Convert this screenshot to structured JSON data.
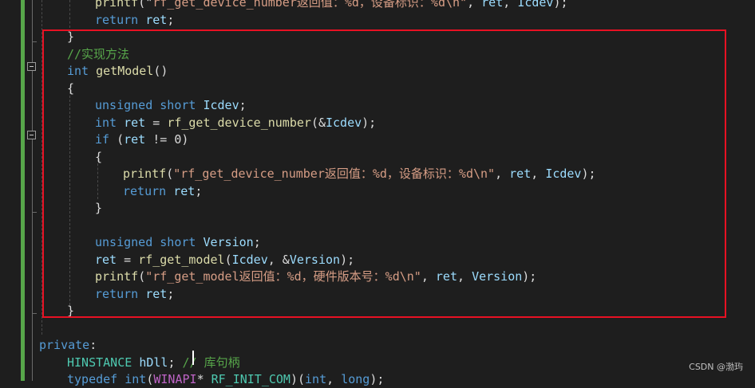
{
  "editor": {
    "lines": [
      {
        "indent": 2,
        "tokens": [
          [
            "fn",
            "printf"
          ],
          [
            "pl",
            "(\""
          ],
          [
            "st",
            "rf_get_device_number返回值：%d，设备标识：%d\\n\""
          ],
          [
            "pl",
            ", "
          ],
          [
            "va",
            "ret"
          ],
          [
            "pl",
            ", "
          ],
          [
            "va",
            "Icdev"
          ],
          [
            "pl",
            ");"
          ]
        ]
      },
      {
        "indent": 2,
        "tokens": [
          [
            "kw",
            "return"
          ],
          [
            "pl",
            " "
          ],
          [
            "va",
            "ret"
          ],
          [
            "pl",
            ";"
          ]
        ]
      },
      {
        "indent": 1,
        "tokens": [
          [
            "pl",
            "}"
          ]
        ]
      },
      {
        "indent": 1,
        "tokens": [
          [
            "cm",
            "//实现方法"
          ]
        ]
      },
      {
        "indent": 1,
        "tokens": [
          [
            "kw",
            "int"
          ],
          [
            "pl",
            " "
          ],
          [
            "fn",
            "getModel"
          ],
          [
            "pl",
            "()"
          ]
        ]
      },
      {
        "indent": 1,
        "tokens": [
          [
            "pl",
            "{"
          ]
        ]
      },
      {
        "indent": 2,
        "tokens": [
          [
            "kw",
            "unsigned short"
          ],
          [
            "pl",
            " "
          ],
          [
            "va",
            "Icdev"
          ],
          [
            "pl",
            ";"
          ]
        ]
      },
      {
        "indent": 2,
        "tokens": [
          [
            "kw",
            "int"
          ],
          [
            "pl",
            " "
          ],
          [
            "va",
            "ret"
          ],
          [
            "pl",
            " = "
          ],
          [
            "fn",
            "rf_get_device_number"
          ],
          [
            "pl",
            "(&"
          ],
          [
            "va",
            "Icdev"
          ],
          [
            "pl",
            ");"
          ]
        ]
      },
      {
        "indent": 2,
        "tokens": [
          [
            "kw",
            "if"
          ],
          [
            "pl",
            " ("
          ],
          [
            "va",
            "ret"
          ],
          [
            "pl",
            " != 0)"
          ]
        ]
      },
      {
        "indent": 2,
        "tokens": [
          [
            "pl",
            "{"
          ]
        ]
      },
      {
        "indent": 3,
        "tokens": [
          [
            "fn",
            "printf"
          ],
          [
            "pl",
            "("
          ],
          [
            "st",
            "\"rf_get_device_number返回值：%d，设备标识：%d\\n\""
          ],
          [
            "pl",
            ", "
          ],
          [
            "va",
            "ret"
          ],
          [
            "pl",
            ", "
          ],
          [
            "va",
            "Icdev"
          ],
          [
            "pl",
            ");"
          ]
        ]
      },
      {
        "indent": 3,
        "tokens": [
          [
            "kw",
            "return"
          ],
          [
            "pl",
            " "
          ],
          [
            "va",
            "ret"
          ],
          [
            "pl",
            ";"
          ]
        ]
      },
      {
        "indent": 2,
        "tokens": [
          [
            "pl",
            "}"
          ]
        ]
      },
      {
        "indent": 0,
        "tokens": []
      },
      {
        "indent": 2,
        "tokens": [
          [
            "kw",
            "unsigned short"
          ],
          [
            "pl",
            " "
          ],
          [
            "va",
            "Version"
          ],
          [
            "pl",
            ";"
          ]
        ]
      },
      {
        "indent": 2,
        "tokens": [
          [
            "va",
            "ret"
          ],
          [
            "pl",
            " = "
          ],
          [
            "fn",
            "rf_get_model"
          ],
          [
            "pl",
            "("
          ],
          [
            "va",
            "Icdev"
          ],
          [
            "pl",
            ", &"
          ],
          [
            "va",
            "Version"
          ],
          [
            "pl",
            ");"
          ]
        ]
      },
      {
        "indent": 2,
        "tokens": [
          [
            "fn",
            "printf"
          ],
          [
            "pl",
            "("
          ],
          [
            "st",
            "\"rf_get_model返回值：%d，硬件版本号：%d\\n\""
          ],
          [
            "pl",
            ", "
          ],
          [
            "va",
            "ret"
          ],
          [
            "pl",
            ", "
          ],
          [
            "va",
            "Version"
          ],
          [
            "pl",
            ");"
          ]
        ]
      },
      {
        "indent": 2,
        "tokens": [
          [
            "kw",
            "return"
          ],
          [
            "pl",
            " "
          ],
          [
            "va",
            "ret"
          ],
          [
            "pl",
            ";"
          ]
        ]
      },
      {
        "indent": 1,
        "tokens": [
          [
            "pl",
            "}"
          ]
        ]
      },
      {
        "indent": 0,
        "tokens": []
      },
      {
        "indent": 0,
        "tokens": [
          [
            "kw",
            "private"
          ],
          [
            "pl",
            ":"
          ]
        ]
      },
      {
        "indent": 1,
        "tokens": [
          [
            "ty",
            "HINSTANCE"
          ],
          [
            "pl",
            " "
          ],
          [
            "va",
            "hDll"
          ],
          [
            "pl",
            "; "
          ],
          [
            "cm",
            "// 库句柄"
          ]
        ]
      },
      {
        "indent": 1,
        "tokens": [
          [
            "kw",
            "typedef"
          ],
          [
            "pl",
            " "
          ],
          [
            "kw",
            "int"
          ],
          [
            "pl",
            "("
          ],
          [
            "mac",
            "WINAPI"
          ],
          [
            "pl",
            "* "
          ],
          [
            "ty",
            "RF_INIT_COM"
          ],
          [
            "pl",
            ")("
          ],
          [
            "kw",
            "int"
          ],
          [
            "pl",
            ", "
          ],
          [
            "kw",
            "long"
          ],
          [
            "pl",
            ");"
          ]
        ]
      }
    ]
  },
  "watermark": "CSDN @渤玙"
}
